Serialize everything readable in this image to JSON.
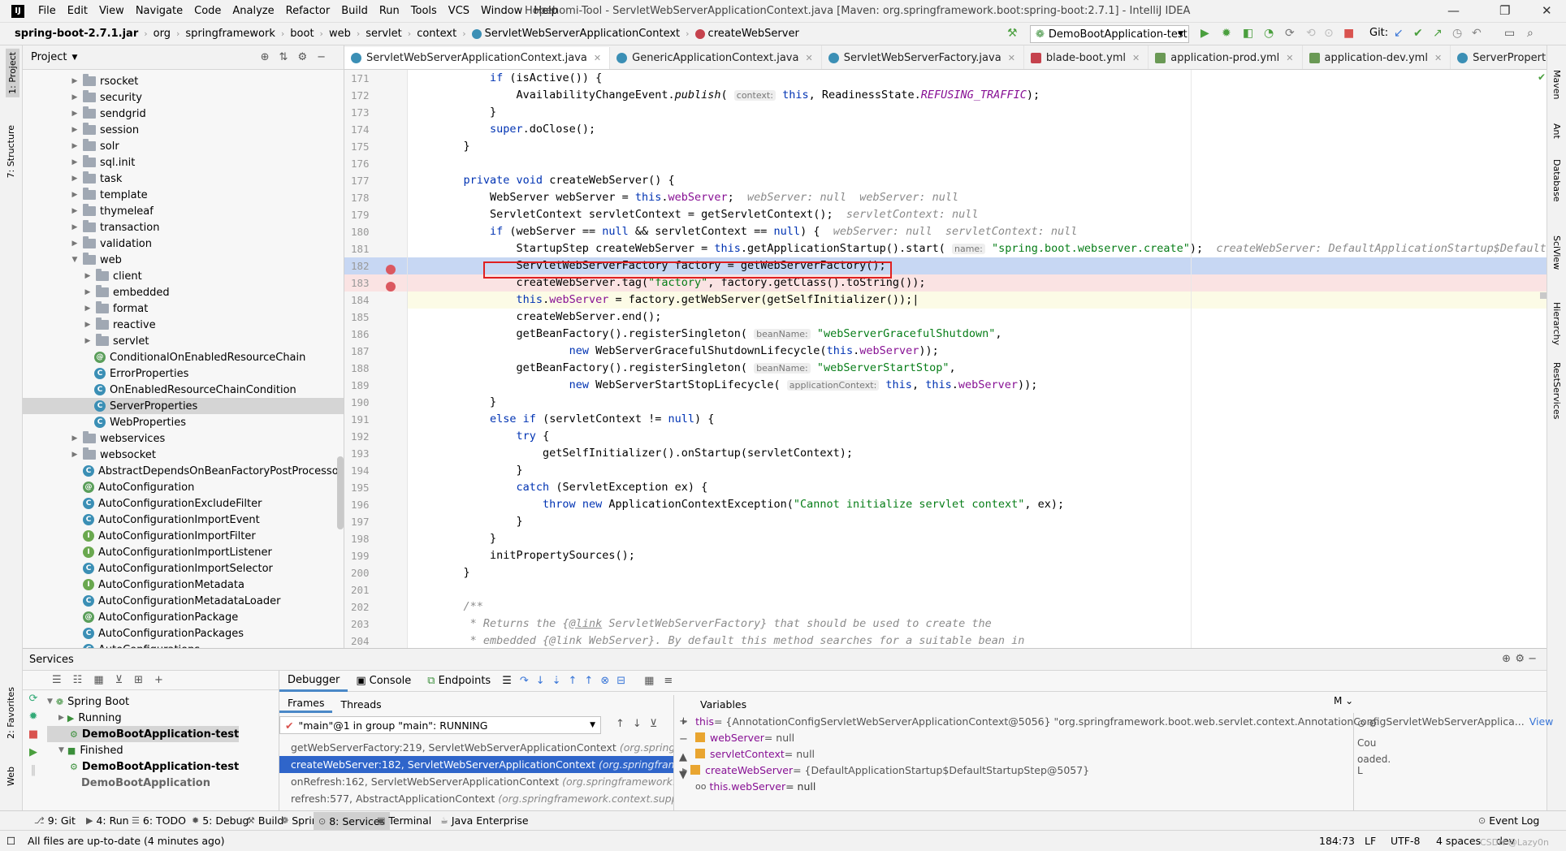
{
  "window": {
    "title": "Hopehomi-Tool - ServletWebServerApplicationContext.java [Maven: org.springframework.boot:spring-boot:2.7.1] - IntelliJ IDEA",
    "controls": [
      "—",
      "❐",
      "✕"
    ]
  },
  "menu": [
    "File",
    "Edit",
    "View",
    "Navigate",
    "Code",
    "Analyze",
    "Refactor",
    "Build",
    "Run",
    "Tools",
    "VCS",
    "Window",
    "Help"
  ],
  "breadcrumb": [
    "spring-boot-2.7.1.jar",
    "org",
    "springframework",
    "boot",
    "web",
    "servlet",
    "context",
    "ServletWebServerApplicationContext",
    "createWebServer"
  ],
  "toolbar": {
    "run_config": "DemoBootApplication-test",
    "git_label": "Git:"
  },
  "left_stripe": [
    "1: Project",
    "7: Structure",
    "2: Favorites",
    "Web"
  ],
  "right_stripe": [
    "Maven",
    "Ant",
    "Database",
    "SciView",
    "Hierarchy",
    "RestServices"
  ],
  "project": {
    "title": "Project",
    "items": [
      {
        "label": "rsocket",
        "type": "folder",
        "level": 0
      },
      {
        "label": "security",
        "type": "folder",
        "level": 0
      },
      {
        "label": "sendgrid",
        "type": "folder",
        "level": 0
      },
      {
        "label": "session",
        "type": "folder",
        "level": 0
      },
      {
        "label": "solr",
        "type": "folder",
        "level": 0
      },
      {
        "label": "sql.init",
        "type": "folder",
        "level": 0
      },
      {
        "label": "task",
        "type": "folder",
        "level": 0
      },
      {
        "label": "template",
        "type": "folder",
        "level": 0
      },
      {
        "label": "thymeleaf",
        "type": "folder",
        "level": 0
      },
      {
        "label": "transaction",
        "type": "folder",
        "level": 0
      },
      {
        "label": "validation",
        "type": "folder",
        "level": 0
      },
      {
        "label": "web",
        "type": "folder-open",
        "level": 0
      },
      {
        "label": "client",
        "type": "folder",
        "level": 1
      },
      {
        "label": "embedded",
        "type": "folder",
        "level": 1
      },
      {
        "label": "format",
        "type": "folder",
        "level": 1
      },
      {
        "label": "reactive",
        "type": "folder",
        "level": 1
      },
      {
        "label": "servlet",
        "type": "folder",
        "level": 1
      },
      {
        "label": "ConditionalOnEnabledResourceChain",
        "type": "annotation",
        "level": 1
      },
      {
        "label": "ErrorProperties",
        "type": "class",
        "level": 1
      },
      {
        "label": "OnEnabledResourceChainCondition",
        "type": "class",
        "level": 1
      },
      {
        "label": "ServerProperties",
        "type": "class",
        "level": 1,
        "selected": true
      },
      {
        "label": "WebProperties",
        "type": "class",
        "level": 1
      },
      {
        "label": "webservices",
        "type": "folder",
        "level": 0
      },
      {
        "label": "websocket",
        "type": "folder",
        "level": 0
      },
      {
        "label": "AbstractDependsOnBeanFactoryPostProcessor",
        "type": "class",
        "level": 0
      },
      {
        "label": "AutoConfiguration",
        "type": "annotation",
        "level": 0
      },
      {
        "label": "AutoConfigurationExcludeFilter",
        "type": "class",
        "level": 0
      },
      {
        "label": "AutoConfigurationImportEvent",
        "type": "class",
        "level": 0
      },
      {
        "label": "AutoConfigurationImportFilter",
        "type": "interface",
        "level": 0
      },
      {
        "label": "AutoConfigurationImportListener",
        "type": "interface",
        "level": 0
      },
      {
        "label": "AutoConfigurationImportSelector",
        "type": "class",
        "level": 0
      },
      {
        "label": "AutoConfigurationMetadata",
        "type": "interface",
        "level": 0
      },
      {
        "label": "AutoConfigurationMetadataLoader",
        "type": "class",
        "level": 0
      },
      {
        "label": "AutoConfigurationPackage",
        "type": "annotation",
        "level": 0
      },
      {
        "label": "AutoConfigurationPackages",
        "type": "class",
        "level": 0
      },
      {
        "label": "AutoConfigurations",
        "type": "class",
        "level": 0
      }
    ]
  },
  "tabs": [
    {
      "label": "ServletWebServerApplicationContext.java",
      "active": true,
      "kind": "java"
    },
    {
      "label": "GenericApplicationContext.java",
      "kind": "java"
    },
    {
      "label": "ServletWebServerFactory.java",
      "kind": "java"
    },
    {
      "label": "blade-boot.yml",
      "kind": "yml"
    },
    {
      "label": "application-prod.yml",
      "kind": "yml2"
    },
    {
      "label": "application-dev.yml",
      "kind": "yml2"
    },
    {
      "label": "ServerProperties.java",
      "kind": "java"
    },
    {
      "label": "WebPro",
      "kind": "java"
    }
  ],
  "editor": {
    "line_numbers": [
      "171",
      "172",
      "173",
      "174",
      "175",
      "176",
      "177",
      "178",
      "179",
      "180",
      "181",
      "182",
      "183",
      "184",
      "185",
      "186",
      "187",
      "188",
      "189",
      "190",
      "191",
      "192",
      "193",
      "194",
      "195",
      "196",
      "197",
      "198",
      "199",
      "200",
      "201",
      "202",
      "203",
      "204"
    ],
    "breakpoint_lines": [
      182,
      183
    ],
    "current_line": 182,
    "caret_line": 184
  },
  "services": {
    "title": "Services",
    "tree": [
      {
        "label": "Spring Boot",
        "level": 0
      },
      {
        "label": "Running",
        "level": 1
      },
      {
        "label": "DemoBootApplication-test",
        "level": 2,
        "selected": true
      },
      {
        "label": "Finished",
        "level": 1
      },
      {
        "label": "DemoBootApplication-test",
        "level": 2,
        "bold": true
      },
      {
        "label": "DemoBootApplication",
        "level": 2,
        "bold": true,
        "muted": true
      }
    ]
  },
  "debugger": {
    "tabs": [
      "Debugger",
      "Console",
      "Endpoints"
    ],
    "frames_tab": "Frames",
    "threads_tab": "Threads",
    "thread": "\"main\"@1 in group \"main\": RUNNING",
    "frames": [
      {
        "method": "getWebServerFactory:219, ServletWebServerApplicationContext",
        "pkg": "(org.springframework"
      },
      {
        "method": "createWebServer:182, ServletWebServerApplicationContext",
        "pkg": "(org.springframework",
        "selected": true
      },
      {
        "method": "onRefresh:162, ServletWebServerApplicationContext",
        "pkg": "(org.springframework.boot."
      },
      {
        "method": "refresh:577, AbstractApplicationContext",
        "pkg": "(org.springframework.context.support)"
      }
    ],
    "variables_title": "Variables",
    "variables": [
      {
        "name": "this",
        "value": " = {AnnotationConfigServletWebServerApplicationContext@5056} \"org.springframework.boot.web.servlet.context.AnnotationConfigServletWebServerApplica...",
        "link": "View",
        "expandable": true
      },
      {
        "name": "webServer",
        "value": " = null"
      },
      {
        "name": "servletContext",
        "value": " = null"
      },
      {
        "name": "createWebServer",
        "value": " = {DefaultApplicationStartup$DefaultStartupStep@5057}",
        "expandable": true
      },
      {
        "name": "this.webServer",
        "value": " = null",
        "watch": true
      }
    ],
    "right_snippets": [
      "Cou",
      "oaded. L"
    ]
  },
  "bottom_tools": [
    {
      "label": "9: Git"
    },
    {
      "label": "4: Run"
    },
    {
      "label": "6: TODO"
    },
    {
      "label": "5: Debug"
    },
    {
      "label": "Build"
    },
    {
      "label": "Spring"
    },
    {
      "label": "8: Services",
      "active": true
    },
    {
      "label": "Terminal"
    },
    {
      "label": "Java Enterprise"
    },
    {
      "label": "Event Log"
    }
  ],
  "status": {
    "message": "All files are up-to-date (4 minutes ago)",
    "position": "184:73",
    "line_sep": "LF",
    "encoding": "UTF-8",
    "indent": "4 spaces",
    "branch": "dev",
    "watermark": "CSDN @Lazy0n"
  }
}
